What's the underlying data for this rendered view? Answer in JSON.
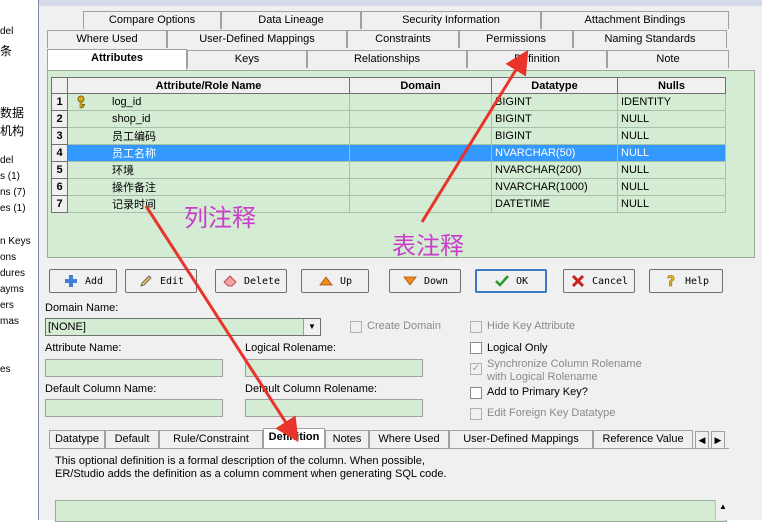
{
  "sidebar_fragments": [
    "del",
    "条",
    "数据",
    "机构",
    "del",
    "s (1)",
    "ns (7)",
    "es (1)",
    "n Keys",
    "ons",
    "dures",
    "ayms",
    "ers",
    "mas",
    "es"
  ],
  "tabs": {
    "row1": [
      "Compare Options",
      "Data Lineage",
      "Security Information",
      "Attachment Bindings"
    ],
    "row2": [
      "Where Used",
      "User-Defined Mappings",
      "Constraints",
      "Permissions",
      "Naming Standards"
    ],
    "row3": [
      "Attributes",
      "Keys",
      "Relationships",
      "Definition",
      "Note"
    ]
  },
  "grid": {
    "headers": [
      "Attribute/Role Name",
      "Domain",
      "Datatype",
      "Nulls"
    ],
    "rows": [
      {
        "num": "1",
        "name": "log_id",
        "domain": "",
        "datatype": "BIGINT",
        "nulls": "IDENTITY"
      },
      {
        "num": "2",
        "name": "shop_id",
        "domain": "",
        "datatype": "BIGINT",
        "nulls": "NULL"
      },
      {
        "num": "3",
        "name": "员工编码",
        "domain": "",
        "datatype": "BIGINT",
        "nulls": "NULL"
      },
      {
        "num": "4",
        "name": "员工名称",
        "domain": "",
        "datatype": "NVARCHAR(50)",
        "nulls": "NULL"
      },
      {
        "num": "5",
        "name": "环境",
        "domain": "",
        "datatype": "NVARCHAR(200)",
        "nulls": "NULL"
      },
      {
        "num": "6",
        "name": "操作备注",
        "domain": "",
        "datatype": "NVARCHAR(1000)",
        "nulls": "NULL"
      },
      {
        "num": "7",
        "name": "记录时间",
        "domain": "",
        "datatype": "DATETIME",
        "nulls": "NULL"
      }
    ]
  },
  "buttons": {
    "add": "Add",
    "edit": "Edit",
    "delete": "Delete",
    "up": "Up",
    "down": "Down",
    "ok": "OK",
    "cancel": "Cancel",
    "help": "Help"
  },
  "form": {
    "domain_name_label": "Domain Name:",
    "domain_name_value": "[NONE]",
    "create_domain": "Create Domain",
    "attribute_name_label": "Attribute Name:",
    "logical_rolename_label": "Logical Rolename:",
    "default_column_name_label": "Default Column Name:",
    "default_column_rolename_label": "Default Column Rolename:",
    "hide_key_attribute": "Hide Key Attribute",
    "logical_only": "Logical Only",
    "sync_column_rolename_1": "Synchronize Column Rolename",
    "sync_column_rolename_2": "with Logical Rolename",
    "add_to_primary_key": "Add to Primary Key?",
    "edit_foreign_key_datatype": "Edit Foreign Key Datatype"
  },
  "bottom_tabs": [
    "Datatype",
    "Default",
    "Rule/Constraint",
    "Definition",
    "Notes",
    "Where Used",
    "User-Defined Mappings",
    "Reference Value"
  ],
  "definition_text_1": "This optional definition is a formal description of the column.  When possible,",
  "definition_text_2": "ER/Studio adds the definition as a column comment when generating SQL code.",
  "annotations": {
    "column_comment": "列注释",
    "table_comment": "表注释"
  },
  "colors": {
    "selection": "#3399ff",
    "grid_bg": "#d4ecd4",
    "annotation": "#cc3ccc",
    "arrow": "#e8342a"
  }
}
